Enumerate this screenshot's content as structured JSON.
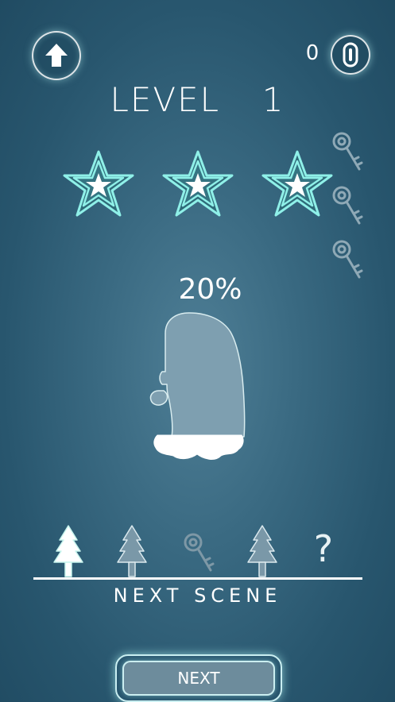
{
  "header": {
    "home_icon": "home-up-arrow-icon",
    "hint_count": "0",
    "hint_icon": "hint-bulb-icon"
  },
  "level": {
    "label": "LEVEL",
    "number": "1"
  },
  "stars": {
    "earned": 3,
    "total": 3,
    "icon": "star-icon",
    "glow_color": "#7ee6e0"
  },
  "keys": {
    "count": 3,
    "icon": "key-icon"
  },
  "puzzle": {
    "progress_text": "20%",
    "progress": 0.2,
    "shape": "santa-hat-silhouette"
  },
  "scenes": {
    "items": [
      {
        "icon": "tree-icon",
        "state": "current"
      },
      {
        "icon": "tree-icon",
        "state": "locked"
      },
      {
        "icon": "key-icon",
        "state": "locked"
      },
      {
        "icon": "tree-icon",
        "state": "locked"
      },
      {
        "icon": "question-icon",
        "state": "unknown",
        "label": "?"
      }
    ],
    "caption": "NEXT SCENE"
  },
  "next_button": {
    "label": "NEXT"
  },
  "colors": {
    "background": "#2b5a72",
    "accent": "#7ee6e0",
    "text": "#ffffff"
  }
}
